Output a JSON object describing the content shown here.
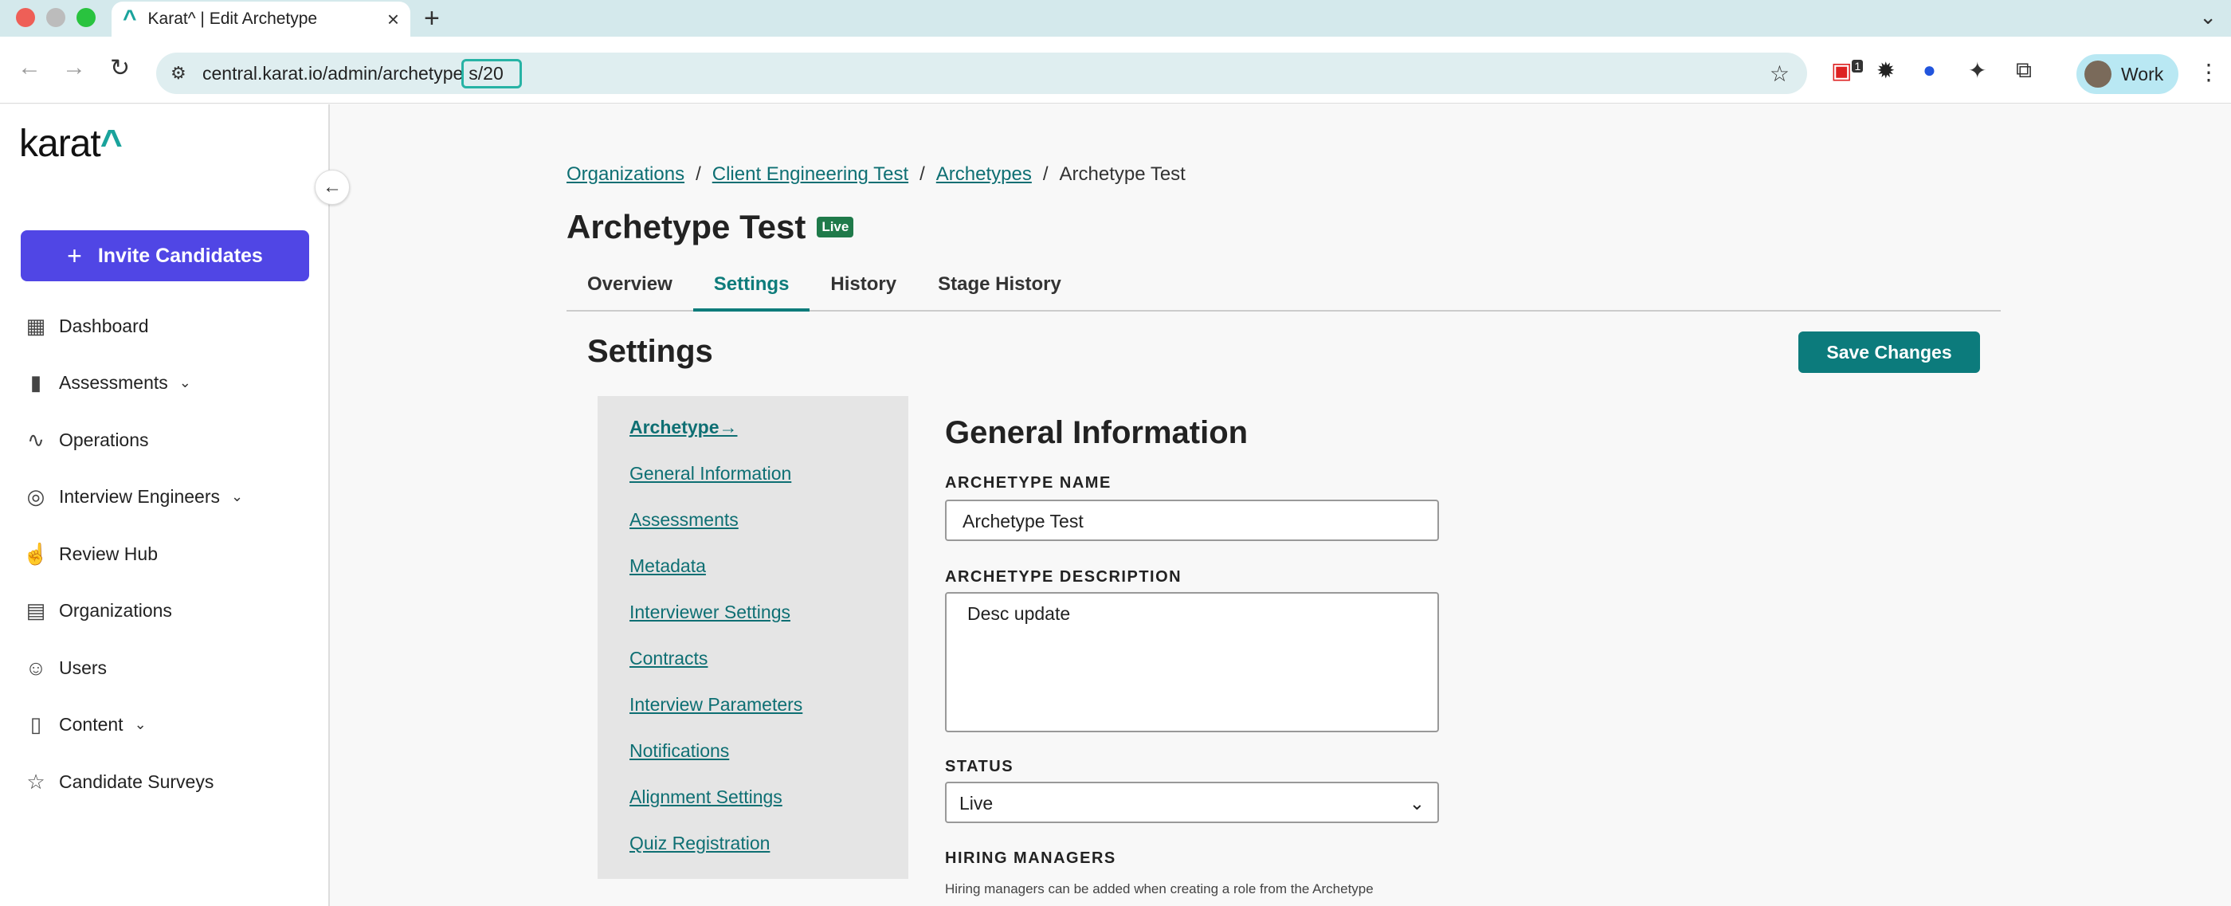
{
  "browser": {
    "tab_title": "Karat^ | Edit Archetype",
    "tab_logo": "^",
    "close_glyph": "×",
    "newtab_glyph": "+",
    "url": "central.karat.io/admin/archetypes/20",
    "url_prefix": "central.karat.io/admin/archetype",
    "url_highlight": "s/20",
    "profile_label": "Work",
    "ext_badge": "1",
    "icons": [
      "back-arrow-icon",
      "forward-arrow-icon",
      "reload-icon",
      "site-settings-icon",
      "bookmark-star-icon",
      "extensions-icon",
      "kebab-menu-icon"
    ],
    "accent": "#27b3a5"
  },
  "sidebar": {
    "brand": "karat",
    "brand_caret": "^",
    "invite_label": "Invite Candidates",
    "items": [
      {
        "label": "Dashboard",
        "icon": "table-icon",
        "has_chevron": false
      },
      {
        "label": "Assessments",
        "icon": "bar-chart-icon",
        "has_chevron": true
      },
      {
        "label": "Operations",
        "icon": "activity-icon",
        "has_chevron": false
      },
      {
        "label": "Interview Engineers",
        "icon": "globe-icon",
        "has_chevron": true
      },
      {
        "label": "Review Hub",
        "icon": "thumbs-up-icon",
        "has_chevron": false
      },
      {
        "label": "Organizations",
        "icon": "building-icon",
        "has_chevron": false
      },
      {
        "label": "Users",
        "icon": "users-icon",
        "has_chevron": false
      },
      {
        "label": "Content",
        "icon": "document-icon",
        "has_chevron": true
      },
      {
        "label": "Candidate Surveys",
        "icon": "star-icon",
        "has_chevron": false
      }
    ],
    "brand_color": "#5046e5"
  },
  "breadcrumb": {
    "items": [
      "Organizations",
      "Client Engineering Test",
      "Archetypes"
    ],
    "current": "Archetype Test",
    "separator": "/"
  },
  "page": {
    "title": "Archetype Test",
    "badge": "Live",
    "tabs": [
      "Overview",
      "Settings",
      "History",
      "Stage History"
    ],
    "active_tab": "Settings",
    "section_title": "Settings",
    "save_label": "Save Changes",
    "accent": "#0c7b7c"
  },
  "subnav": {
    "items": [
      "Archetype",
      "General Information",
      "Assessments",
      "Metadata",
      "Interviewer Settings",
      "Contracts",
      "Interview Parameters",
      "Notifications",
      "Alignment Settings",
      "Quiz Registration"
    ],
    "active": "Archetype",
    "active_arrow": "→"
  },
  "form": {
    "heading": "General Information",
    "name_label": "ARCHETYPE NAME",
    "name_value": "Archetype Test",
    "desc_label": "ARCHETYPE DESCRIPTION",
    "desc_value": "Desc update",
    "status_label": "STATUS",
    "status_value": "Live",
    "hm_label": "HIRING MANAGERS",
    "hm_help": "Hiring managers can be added when creating a role from the Archetype"
  }
}
